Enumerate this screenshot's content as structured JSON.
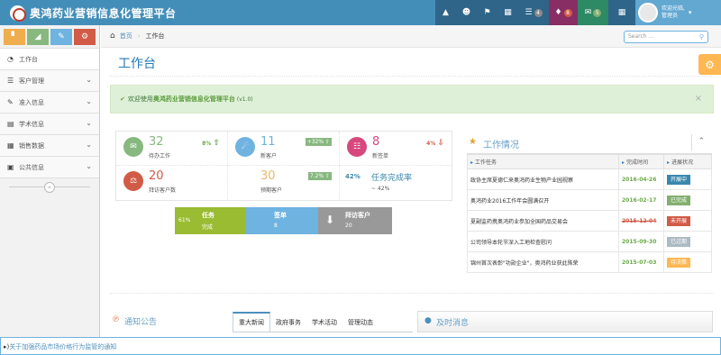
{
  "app": {
    "title": "奥鸿药业营销信息化管理平台"
  },
  "topbar": {
    "badges": {
      "mail_box": "4",
      "bell": "8",
      "envelope": "5"
    },
    "user": {
      "greeting": "欢迎光临,",
      "role": "管理员"
    }
  },
  "shortcuts": [
    {
      "icon": "signal-icon",
      "color": "#f0ad4e"
    },
    {
      "icon": "chart-icon",
      "color": "#87b87f"
    },
    {
      "icon": "pencil-icon",
      "color": "#6fb3e0"
    },
    {
      "icon": "cogs-icon",
      "color": "#d15b47"
    }
  ],
  "sidebar": {
    "items": [
      {
        "label": "工作台",
        "icon": "dashboard-icon"
      },
      {
        "label": "客户管理",
        "icon": "list-icon"
      },
      {
        "label": "准入信息",
        "icon": "edit-icon"
      },
      {
        "label": "学术信息",
        "icon": "list-alt-icon"
      },
      {
        "label": "销售数据",
        "icon": "calendar-icon"
      },
      {
        "label": "公共信息",
        "icon": "picture-icon"
      }
    ]
  },
  "breadcrumb": {
    "home": "首页",
    "current": "工作台"
  },
  "search": {
    "placeholder": "Search ..."
  },
  "page": {
    "title": "工作台"
  },
  "alert": {
    "prefix": "欢迎使用",
    "product": "奥鸿药业营销信息化管理平台",
    "version": "(v1.0)"
  },
  "stats": [
    {
      "number": "32",
      "label": "待办工作",
      "change": "8%",
      "dir": "up",
      "icon": "comments-icon",
      "color": "#87b87f"
    },
    {
      "number": "11",
      "label": "新客户",
      "change": "+32%",
      "dir": "up",
      "icon": "twitter-icon",
      "color": "#6fb3e0"
    },
    {
      "number": "8",
      "label": "新签单",
      "change": "4%",
      "dir": "down",
      "icon": "cart-icon",
      "color": "#d6487e"
    },
    {
      "number": "20",
      "label": "拜访客户数",
      "icon": "flask-icon",
      "color": "#d15b47"
    },
    {
      "number": "30",
      "label": "预期客户",
      "change": "7.2%",
      "dir": "up"
    },
    {
      "percent": "42%",
      "label": "任务完成率",
      "sub": "~ 42%"
    }
  ],
  "tiles": [
    {
      "left": "61%",
      "title": "任务",
      "sub": "完成",
      "color": "#9abc32",
      "progress": 0.61
    },
    {
      "title": "签单",
      "sub": "8",
      "color": "#6fb3e0"
    },
    {
      "title": "拜访客户",
      "sub": "20",
      "color": "#999999",
      "icon": "download-icon"
    }
  ],
  "work": {
    "title": "工作情况",
    "columns": [
      "工作任务",
      "完成时间",
      "进展状况"
    ],
    "rows": [
      {
        "task": "政协主席夏德仁来奥鸿药业生物产业园视察",
        "date": "2016-04-26",
        "status": "开展中",
        "color": "#3a87ad",
        "strike": false
      },
      {
        "task": "奥鸿药业2016工作年会圆满召开",
        "date": "2016-02-17",
        "status": "已完成",
        "color": "#82af6f",
        "strike": false
      },
      {
        "task": "夏副监药携奥鸿药业参加全国药品交易会",
        "date": "2015-12-04",
        "status": "未开展",
        "color": "#d15b47",
        "strike": true
      },
      {
        "task": "公司领导本轮节深入工地检查慰问",
        "date": "2015-09-30",
        "status": "已过期",
        "color": "#abbac3",
        "strike": false
      },
      {
        "task": "锦州首次表彰\"功勋企业\"，奥鸿药业获此殊荣",
        "date": "2015-07-03",
        "status": "待决策",
        "color": "#ffb752",
        "strike": false
      }
    ]
  },
  "notice": {
    "title": "通知公告"
  },
  "news_tabs": [
    "重大新闻",
    "政府事务",
    "学术活动",
    "管理动态"
  ],
  "chat": {
    "title": "及时消息"
  },
  "ticker": {
    "text": "关于加强药品市场价格行为监管的通知"
  }
}
